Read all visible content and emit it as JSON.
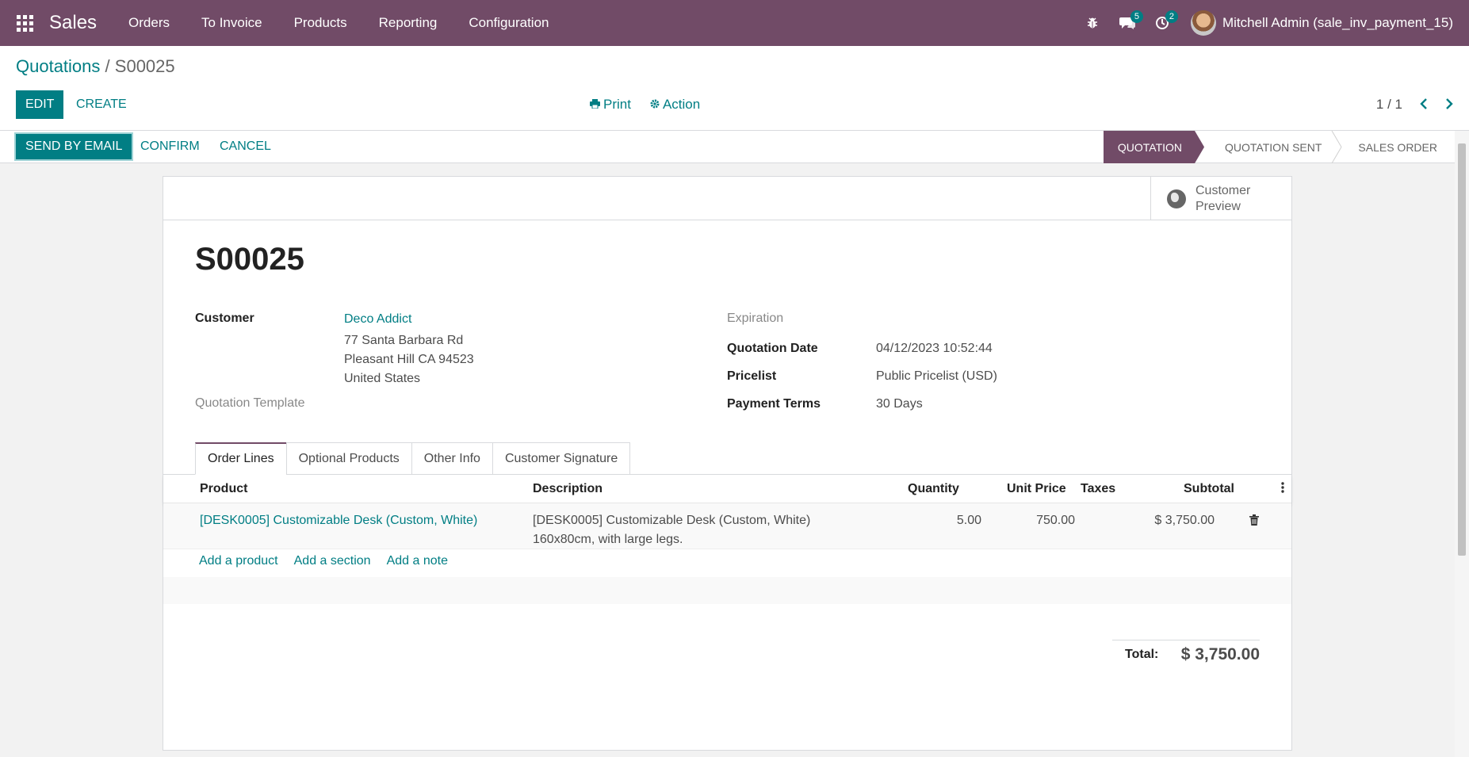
{
  "navbar": {
    "app_name": "Sales",
    "menu": [
      "Orders",
      "To Invoice",
      "Products",
      "Reporting",
      "Configuration"
    ],
    "messages_count": "5",
    "activities_count": "2",
    "user_name": "Mitchell Admin (sale_inv_payment_15)",
    "brand_color": "#714b67"
  },
  "control_panel": {
    "breadcrumb_parent": "Quotations",
    "breadcrumb_sep": "/",
    "breadcrumb_current": "S00025",
    "edit_label": "EDIT",
    "create_label": "CREATE",
    "print_label": "Print",
    "action_label": "Action",
    "pager": "1 / 1"
  },
  "status_bar": {
    "send_email_label": "SEND BY EMAIL",
    "confirm_label": "CONFIRM",
    "cancel_label": "CANCEL",
    "stages": [
      "QUOTATION",
      "QUOTATION SENT",
      "SALES ORDER"
    ],
    "active_stage": "QUOTATION"
  },
  "sheet": {
    "smart_button_line1": "Customer",
    "smart_button_line2": "Preview",
    "name": "S00025",
    "customer_label": "Customer",
    "customer_name": "Deco Addict",
    "customer_address": [
      "77 Santa Barbara Rd",
      "Pleasant Hill CA 94523",
      "United States"
    ],
    "quotation_template_label": "Quotation Template",
    "expiration_label": "Expiration",
    "quotation_date_label": "Quotation Date",
    "quotation_date": "04/12/2023 10:52:44",
    "pricelist_label": "Pricelist",
    "pricelist": "Public Pricelist (USD)",
    "payment_terms_label": "Payment Terms",
    "payment_terms": "30 Days"
  },
  "tabs": [
    "Order Lines",
    "Optional Products",
    "Other Info",
    "Customer Signature"
  ],
  "order_lines": {
    "columns": {
      "product": "Product",
      "description": "Description",
      "quantity": "Quantity",
      "unit_price": "Unit Price",
      "taxes": "Taxes",
      "subtotal": "Subtotal"
    },
    "rows": [
      {
        "product": "[DESK0005] Customizable Desk (Custom, White)",
        "description_line1": "[DESK0005] Customizable Desk (Custom, White)",
        "description_line2": "160x80cm, with large legs.",
        "quantity": "5.00",
        "unit_price": "750.00",
        "taxes": "",
        "subtotal": "$ 3,750.00"
      }
    ],
    "add_product": "Add a product",
    "add_section": "Add a section",
    "add_note": "Add a note"
  },
  "totals": {
    "label": "Total:",
    "value": "$ 3,750.00"
  }
}
